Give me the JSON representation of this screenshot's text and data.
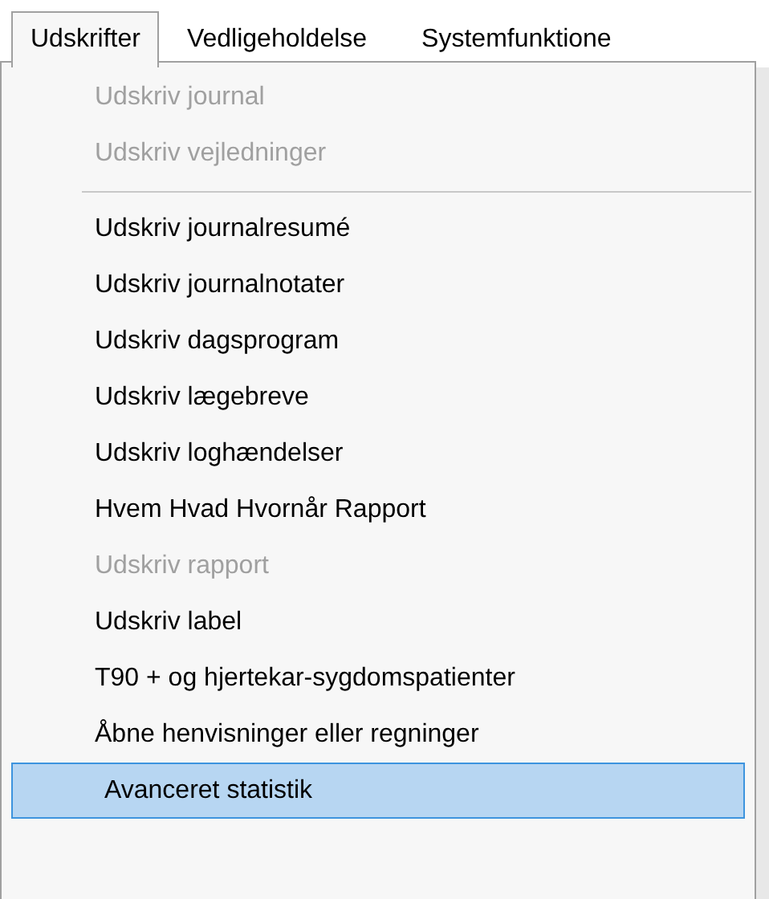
{
  "menu_bar": [
    {
      "label": "Udskrifter",
      "selected": true
    },
    {
      "label": "Vedligeholdelse",
      "selected": false
    },
    {
      "label": "Systemfunktione",
      "selected": false
    }
  ],
  "menu": [
    {
      "kind": "item",
      "label": "Udskriv journal",
      "disabled": true,
      "selected": false
    },
    {
      "kind": "item",
      "label": "Udskriv vejledninger",
      "disabled": true,
      "selected": false
    },
    {
      "kind": "separator"
    },
    {
      "kind": "item",
      "label": "Udskriv journalresumé",
      "disabled": false,
      "selected": false
    },
    {
      "kind": "item",
      "label": "Udskriv journalnotater",
      "disabled": false,
      "selected": false
    },
    {
      "kind": "item",
      "label": "Udskriv dagsprogram",
      "disabled": false,
      "selected": false
    },
    {
      "kind": "item",
      "label": "Udskriv lægebreve",
      "disabled": false,
      "selected": false
    },
    {
      "kind": "item",
      "label": "Udskriv loghændelser",
      "disabled": false,
      "selected": false
    },
    {
      "kind": "item",
      "label": "Hvem Hvad Hvornår Rapport",
      "disabled": false,
      "selected": false
    },
    {
      "kind": "item",
      "label": "Udskriv rapport",
      "disabled": true,
      "selected": false
    },
    {
      "kind": "item",
      "label": "Udskriv label",
      "disabled": false,
      "selected": false
    },
    {
      "kind": "item",
      "label": "T90 + og hjertekar-sygdomspatienter",
      "disabled": false,
      "selected": false
    },
    {
      "kind": "item",
      "label": "Åbne henvisninger eller regninger",
      "disabled": false,
      "selected": false
    },
    {
      "kind": "item",
      "label": "Avanceret statistik",
      "disabled": false,
      "selected": true
    }
  ]
}
